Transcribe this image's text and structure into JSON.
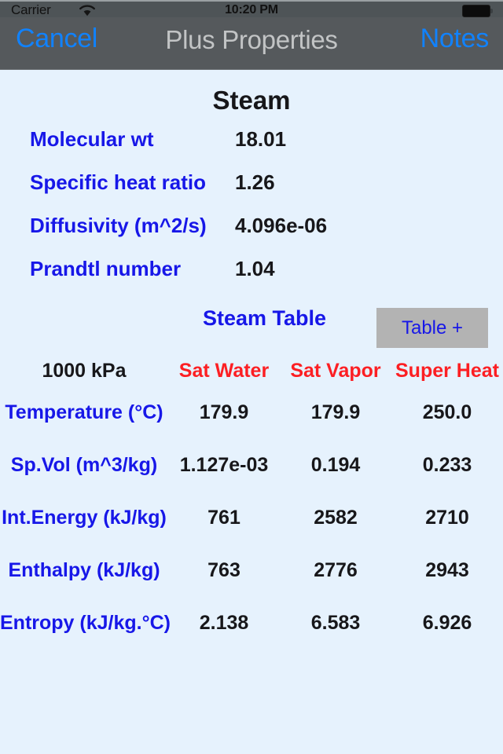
{
  "status_bar": {
    "carrier": "Carrier",
    "wifi_icon": "wifi-icon",
    "time": "10:20 PM",
    "battery_icon": "battery-full-icon"
  },
  "nav_bar": {
    "cancel_label": "Cancel",
    "title": "Plus Properties",
    "notes_label": "Notes"
  },
  "content": {
    "substance_title": "Steam",
    "properties": [
      {
        "label": "Molecular wt",
        "value": "18.01"
      },
      {
        "label": "Specific heat ratio",
        "value": "1.26"
      },
      {
        "label": "Diffusivity (m^2/s)",
        "value": "4.096e-06"
      },
      {
        "label": "Prandtl number",
        "value": "1.04"
      }
    ],
    "steam_table_title": "Steam Table",
    "table_plus_label": "Table +",
    "table": {
      "pressure_header": "1000 kPa",
      "column_headers": [
        "Sat Water",
        "Sat Vapor",
        "Super Heat"
      ],
      "rows": [
        {
          "label": "Temperature (°C)",
          "values": [
            "179.9",
            "179.9",
            "250.0"
          ]
        },
        {
          "label": "Sp.Vol (m^3/kg)",
          "values": [
            "1.127e-03",
            "0.194",
            "0.233"
          ]
        },
        {
          "label": "Int.Energy (kJ/kg)",
          "values": [
            "761",
            "2582",
            "2710"
          ]
        },
        {
          "label": "Enthalpy (kJ/kg)",
          "values": [
            "763",
            "2776",
            "2943"
          ]
        },
        {
          "label": "Entropy (kJ/kg.°C)",
          "values": [
            "2.138",
            "6.583",
            "6.926"
          ]
        }
      ]
    }
  },
  "colors": {
    "content_background": "#e6f2fd",
    "nav_background": "#55595c",
    "status_background": "#4e5457",
    "label_blue": "#1717e8",
    "link_blue": "#1082ff",
    "header_red": "#fc1f23",
    "value_black": "#17171a",
    "button_gray": "#b3b3b3"
  }
}
